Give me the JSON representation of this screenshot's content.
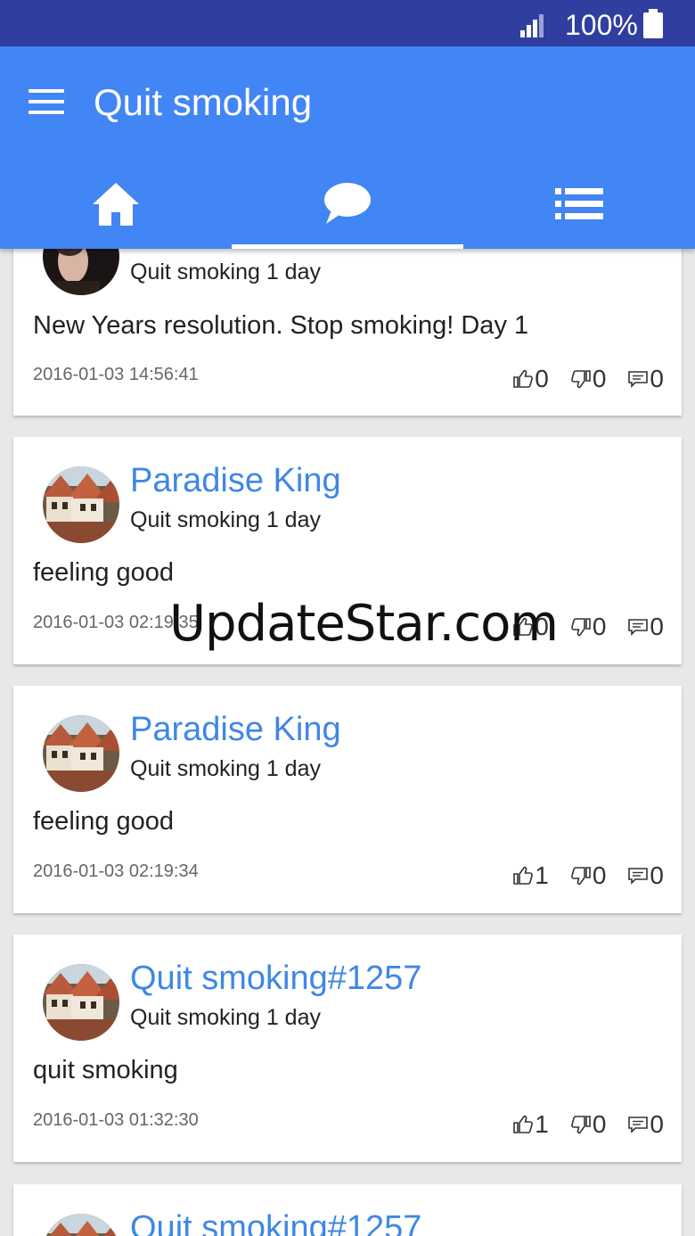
{
  "status_bar": {
    "battery_text": "100%",
    "icons": [
      "signal-icon",
      "battery-icon"
    ]
  },
  "app_bar": {
    "title": "Quit smoking",
    "menu_icon": "hamburger-menu-icon",
    "tabs": [
      {
        "icon": "home-icon",
        "active": false
      },
      {
        "icon": "chat-bubble-icon",
        "active": true
      },
      {
        "icon": "list-icon",
        "active": false
      }
    ]
  },
  "colors": {
    "status_bar": "#303f9f",
    "app_bar": "#4285f4",
    "username": "#3f87e6",
    "background": "#e8e8e8"
  },
  "posts": [
    {
      "username": "",
      "status": "Quit smoking 1 day",
      "text": "New Years resolution. Stop smoking! Day 1",
      "timestamp": "2016-01-03 14:56:41",
      "likes": "0",
      "dislikes": "0",
      "comments": "0"
    },
    {
      "username": "Paradise King",
      "status": "Quit smoking 1 day",
      "text": "feeling good",
      "timestamp": "2016-01-03 02:19:35",
      "likes": "0",
      "dislikes": "0",
      "comments": "0"
    },
    {
      "username": "Paradise King",
      "status": "Quit smoking 1 day",
      "text": "feeling good",
      "timestamp": "2016-01-03 02:19:34",
      "likes": "1",
      "dislikes": "0",
      "comments": "0"
    },
    {
      "username": "Quit smoking#1257",
      "status": "Quit smoking 1 day",
      "text": "quit smoking",
      "timestamp": "2016-01-03 01:32:30",
      "likes": "1",
      "dislikes": "0",
      "comments": "0"
    },
    {
      "username": "Quit smoking#1257"
    }
  ],
  "watermark": "UpdateStar.com"
}
